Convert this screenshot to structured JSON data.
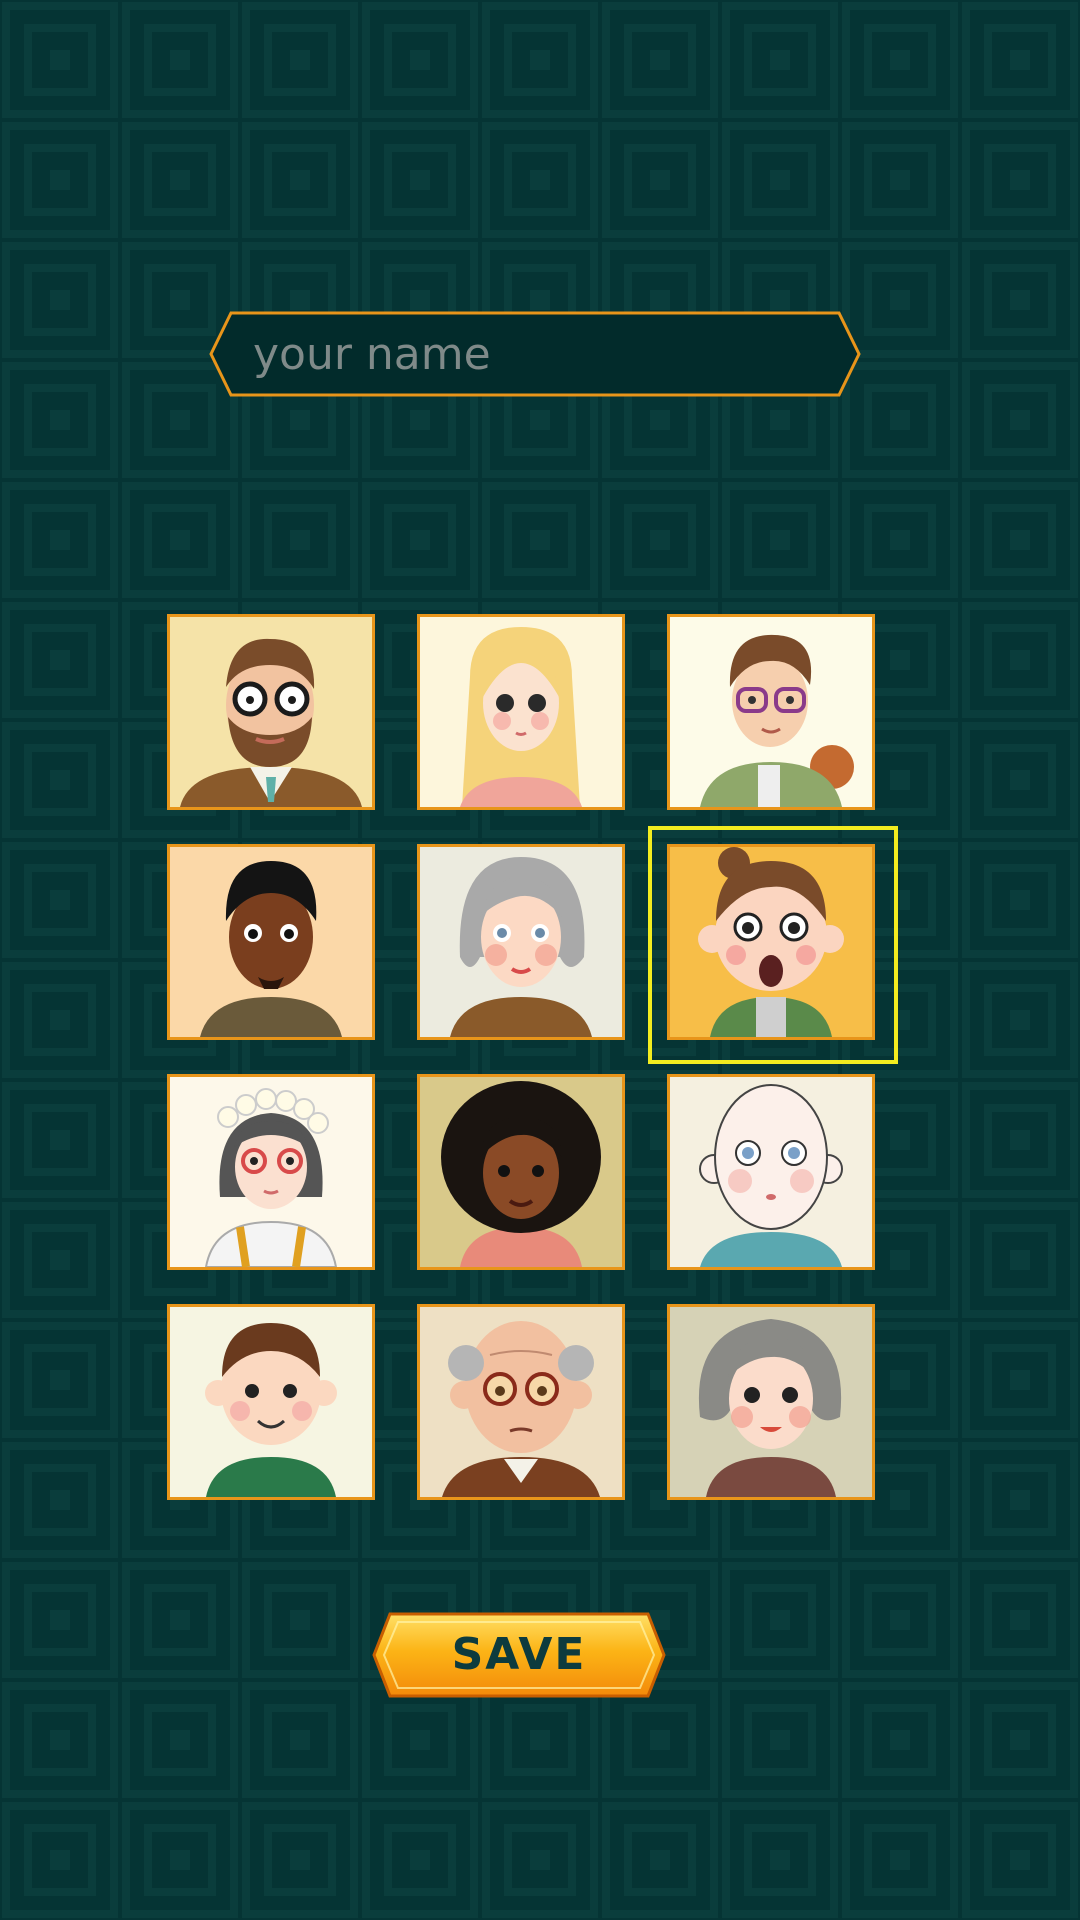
{
  "name_field": {
    "placeholder": "your name",
    "value": ""
  },
  "avatars": {
    "selected_index": 5,
    "items": [
      {
        "icon": "bearded-man-glasses-avatar-icon",
        "bg": "#f5e3a8"
      },
      {
        "icon": "blonde-girl-avatar-icon",
        "bg": "#fdf6dc"
      },
      {
        "icon": "boy-purple-glasses-avatar-icon",
        "bg": "#fdfbe8"
      },
      {
        "icon": "dark-skinned-man-avatar-icon",
        "bg": "#fbd8a8"
      },
      {
        "icon": "gray-haired-woman-avatar-icon",
        "bg": "#ecebdf"
      },
      {
        "icon": "surprised-girl-bun-avatar-icon",
        "bg": "#f7be48"
      },
      {
        "icon": "girl-flower-crown-avatar-icon",
        "bg": "#fdf8ea"
      },
      {
        "icon": "curly-haired-woman-avatar-icon",
        "bg": "#d9c98a"
      },
      {
        "icon": "bald-kid-avatar-icon",
        "bg": "#f5f0e0"
      },
      {
        "icon": "smiling-boy-avatar-icon",
        "bg": "#f6f5e2"
      },
      {
        "icon": "old-bald-man-glasses-avatar-icon",
        "bg": "#eee0c4"
      },
      {
        "icon": "gray-curly-woman-avatar-icon",
        "bg": "#d6d2b6"
      }
    ]
  },
  "save_button": {
    "label": "SAVE"
  },
  "colors": {
    "background": "#053434",
    "frame": "#e8951a",
    "selection": "#f3ec1f",
    "button": "#fcac0c",
    "button_text": "#0d3b3e"
  }
}
